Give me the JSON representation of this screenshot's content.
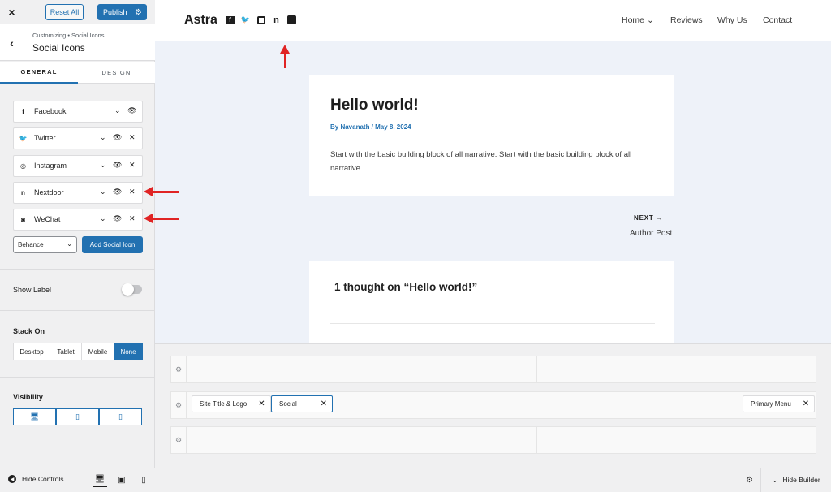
{
  "sidebar": {
    "close_icon": "×",
    "reset_label": "Reset All",
    "publish_label": "Publish",
    "breadcrumb": "Customizing • Social Icons",
    "section_title": "Social Icons",
    "tabs": [
      "GENERAL",
      "DESIGN"
    ],
    "social_items": [
      {
        "label": "Facebook",
        "icon": "facebook-icon",
        "glyph": "f"
      },
      {
        "label": "Twitter",
        "icon": "twitter-icon",
        "glyph": "🐦"
      },
      {
        "label": "Instagram",
        "icon": "instagram-icon",
        "glyph": "◎"
      },
      {
        "label": "Nextdoor",
        "icon": "nextdoor-icon",
        "glyph": "n"
      },
      {
        "label": "WeChat",
        "icon": "wechat-icon",
        "glyph": "◙"
      }
    ],
    "select_value": "Behance",
    "add_button": "Add Social Icon",
    "show_label": "Show Label",
    "show_label_on": false,
    "stack_on_label": "Stack On",
    "stack_options": [
      "Desktop",
      "Tablet",
      "Mobile",
      "None"
    ],
    "stack_selected": "None",
    "visibility_label": "Visibility",
    "hide_controls": "Hide Controls"
  },
  "site": {
    "logo": "Astra",
    "nav": [
      "Home",
      "Reviews",
      "Why Us",
      "Contact"
    ],
    "nav_home_dropdown": "⌄"
  },
  "post": {
    "title": "Hello world!",
    "meta": "By Navanath / May 8, 2024",
    "body": "Start with the basic building block of all narrative. Start with the basic building block of all narrative.",
    "next_label": "NEXT →",
    "next_post": "Author Post",
    "comments_title": "1 thought on “Hello world!”"
  },
  "builder": {
    "chips": [
      "Site Title & Logo",
      "Social",
      "Primary Menu"
    ],
    "hide_builder": "Hide Builder"
  },
  "colors": {
    "accent": "#2271b1",
    "annotation": "#e02424"
  }
}
